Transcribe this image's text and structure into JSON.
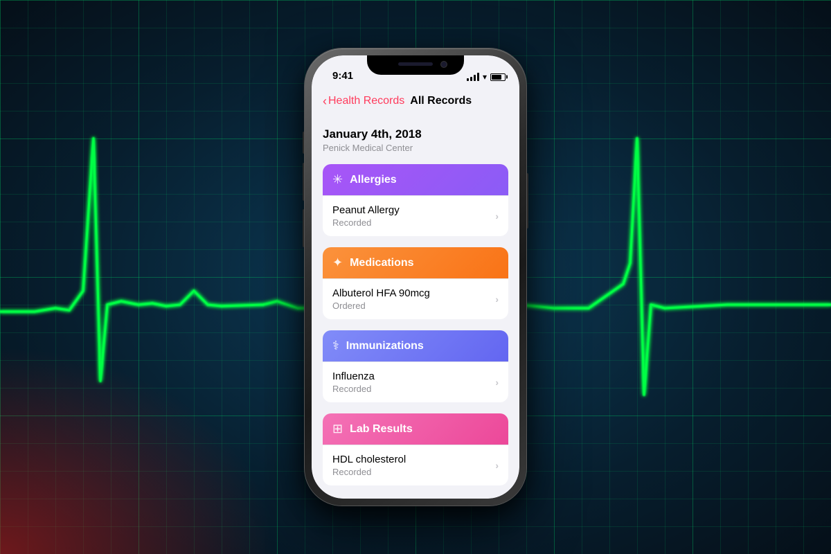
{
  "background": {
    "primary_color": "#0a2a3a",
    "grid_color": "rgba(0,200,100,0.15)"
  },
  "phone": {
    "status_bar": {
      "time": "9:41",
      "signal_label": "signal",
      "wifi_label": "wifi",
      "battery_label": "battery"
    },
    "nav": {
      "back_section": "Health Records",
      "current_section": "All Records"
    },
    "record": {
      "date": "January 4th, 2018",
      "facility": "Penick Medical Center"
    },
    "categories": [
      {
        "id": "allergies",
        "title": "Allergies",
        "icon": "✳",
        "items": [
          {
            "name": "Peanut Allergy",
            "status": "Recorded"
          }
        ]
      },
      {
        "id": "medications",
        "title": "Medications",
        "icon": "✦",
        "items": [
          {
            "name": "Albuterol HFA 90mcg",
            "status": "Ordered"
          }
        ]
      },
      {
        "id": "immunizations",
        "title": "Immunizations",
        "icon": "⟨",
        "items": [
          {
            "name": "Influenza",
            "status": "Recorded"
          }
        ]
      },
      {
        "id": "lab-results",
        "title": "Lab Results",
        "icon": "▦",
        "items": [
          {
            "name": "HDL cholesterol",
            "status": "Recorded"
          }
        ]
      }
    ]
  }
}
